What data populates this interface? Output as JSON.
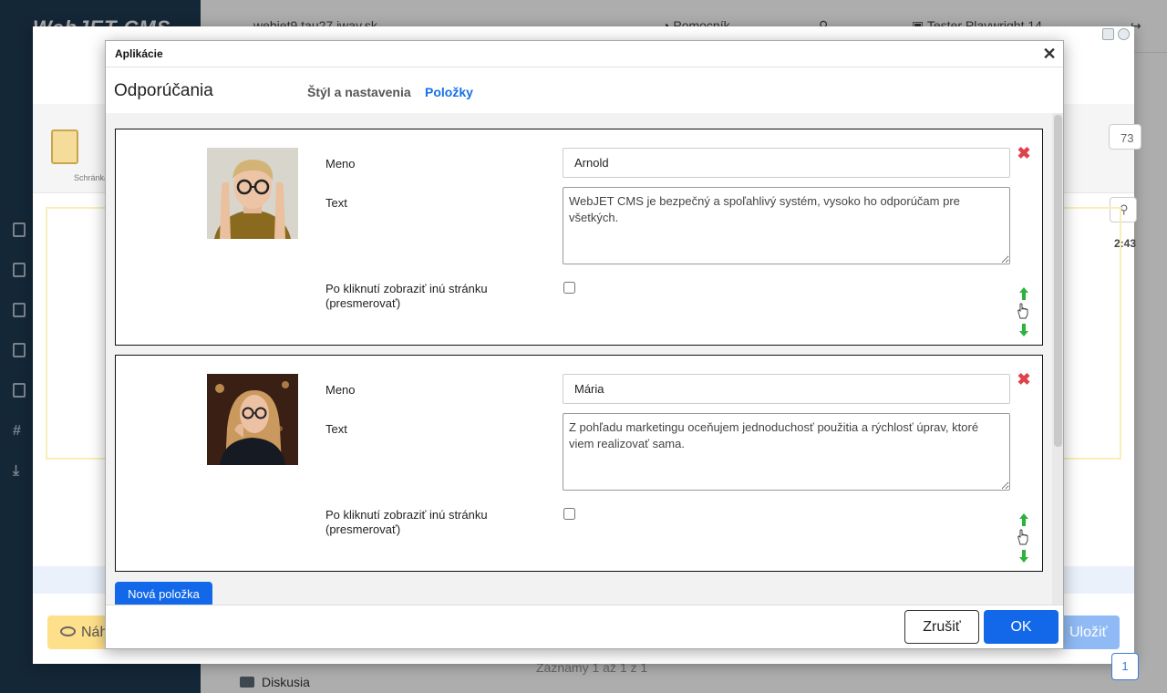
{
  "background": {
    "logo": "WebJET CMS",
    "host": "webjet9.tau27.iway.sk",
    "manual": "Pomocník",
    "user": "Tester Playwright 14",
    "clipboard_label": "Schránka",
    "preview_label": "Náhľad",
    "save_label": "Uložiť",
    "sidebar_folder": "Diskusia",
    "records": "Záznamy 1 až 1 z 1",
    "page_number": "1",
    "time_fragment": "2:43",
    "count_fragment": "73"
  },
  "dialog": {
    "window_title": "Aplikácie",
    "app_title": "Odporúčania",
    "tabs": [
      {
        "label": "Štýl a nastavenia"
      },
      {
        "label": "Položky"
      }
    ],
    "fields": {
      "name_label": "Meno",
      "text_label": "Text",
      "redirect_label": "Po kliknutí zobraziť inú stránku (presmerovať)"
    },
    "items": [
      {
        "name": "Arnold",
        "text": "WebJET CMS je bezpečný a spoľahlivý systém, vysoko ho odporúčam pre všetkých.",
        "redirect": false
      },
      {
        "name": "Mária",
        "text": "Z pohľadu marketingu oceňujem jednoduchosť použitia a rýchlosť úprav, ktoré viem realizovať sama.",
        "redirect": false
      }
    ],
    "new_item_label": "Nová položka",
    "cancel_label": "Zrušiť",
    "ok_label": "OK",
    "close_symbol": "✕",
    "delete_symbol": "✖"
  },
  "colors": {
    "accent": "#1268e8",
    "delete": "#e0424c",
    "arrows": "#2db33d",
    "sidebar": "#1e3a52"
  }
}
